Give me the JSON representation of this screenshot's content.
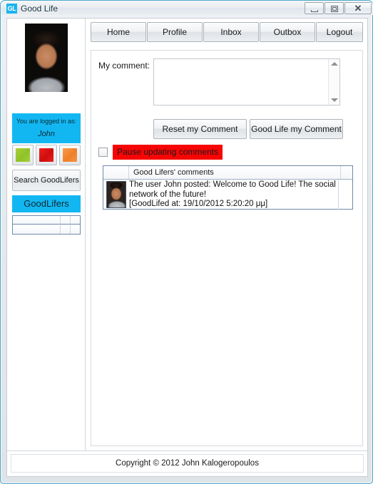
{
  "window": {
    "title": "Good Life",
    "app_icon_text": "GL",
    "controls": {
      "minimize": "minimize-icon",
      "maximize": "restore-icon",
      "close": "✕"
    },
    "border_color": "#4aa8c8"
  },
  "sidebar": {
    "avatar_alt": "user-profile-photo",
    "logged_in_label": "You are logged in as:",
    "username": "John",
    "accent_color": "#12b7f2",
    "color_buttons": [
      {
        "name": "green-status-button",
        "color": "#8fc128"
      },
      {
        "name": "red-status-button",
        "color": "#cf0d0d"
      },
      {
        "name": "orange-status-button",
        "color": "#ef7f28"
      }
    ],
    "search_button_label": "Search GoodLifers",
    "goodlifers_header": "GoodLifers",
    "goodlifers_rows": []
  },
  "nav": {
    "items": [
      {
        "label": "Home"
      },
      {
        "label": "Profile"
      },
      {
        "label": "Inbox"
      },
      {
        "label": "Outbox"
      },
      {
        "label": "Logout"
      }
    ]
  },
  "form": {
    "comment_label": "My comment:",
    "comment_value": "",
    "comment_placeholder": "",
    "reset_button_label": "Reset my Comment",
    "post_button_label": "Good Life my Comment",
    "pause_checkbox_checked": false,
    "pause_label": "Pause updating comments",
    "pause_highlight_color": "#f70505"
  },
  "comments": {
    "column_header": "Good Lifers' comments",
    "rows": [
      {
        "avatar_alt": "commenter-avatar",
        "line1": "The user John posted: Welcome to Good Life! The social",
        "line2": "network of the future!",
        "line3": "[GoodLifed at: 19/10/2012 5:20:20 μμ]"
      }
    ]
  },
  "footer": {
    "copyright": "Copyright © 2012 John Kalogeropoulos"
  }
}
